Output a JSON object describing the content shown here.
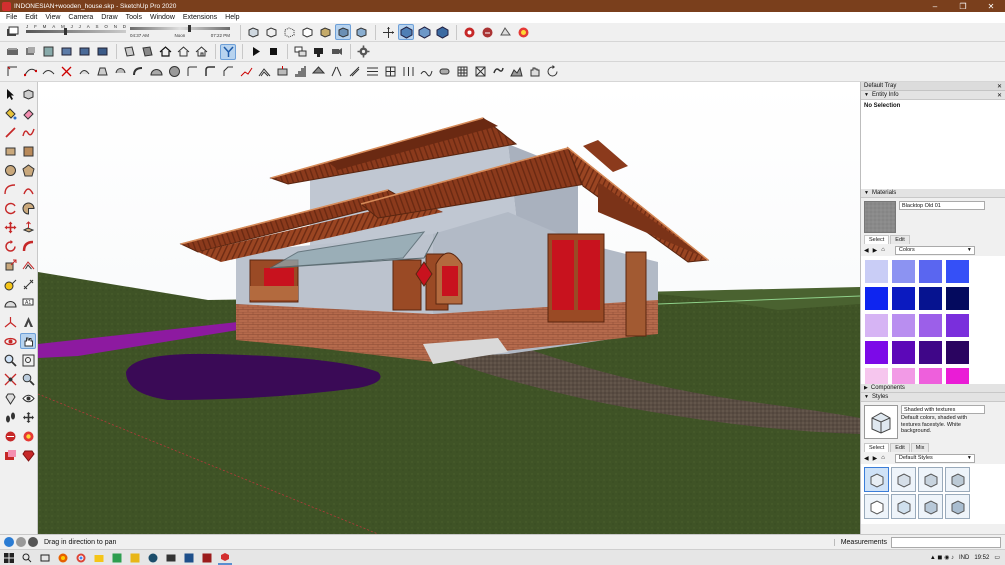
{
  "window": {
    "title": "INDONESIAN+wooden_house.skp - SketchUp Pro 2020",
    "minimize": "–",
    "maximize": "❐",
    "close": "✕"
  },
  "menu": [
    "File",
    "Edit",
    "View",
    "Camera",
    "Draw",
    "Tools",
    "Window",
    "Extensions",
    "Help"
  ],
  "shadow": {
    "months": [
      "J",
      "F",
      "M",
      "A",
      "M",
      "J",
      "J",
      "A",
      "S",
      "O",
      "N",
      "D"
    ],
    "times": [
      "04:37 AM",
      "Noon",
      "07:22 PM"
    ]
  },
  "tray": {
    "title": "Default Tray",
    "entity_info": {
      "title": "Entity Info",
      "selection": "No Selection"
    },
    "materials": {
      "title": "Materials",
      "current": "Blacktop Old 01",
      "tabs": [
        "Select",
        "Edit"
      ],
      "library": "Colors",
      "swatches": [
        "#c9cdf6",
        "#8c93f2",
        "#5a66f0",
        "#3550f7",
        "#0e25f0",
        "#0b1ac0",
        "#061390",
        "#040a5e",
        "#d6b4f4",
        "#b98ef0",
        "#9c5fe9",
        "#7a2fdc",
        "#7c0ae8",
        "#5c08b8",
        "#3f0688",
        "#2a0460",
        "#f6c6ee",
        "#f29ae6",
        "#ee5fdc",
        "#ea1cd6"
      ]
    },
    "components": {
      "title": "Components"
    },
    "styles": {
      "title": "Styles",
      "name": "Shaded with textures",
      "description": "Default colors, shaded with textures facestyle. White background.",
      "tabs": [
        "Select",
        "Edit",
        "Mix"
      ],
      "library": "Default Styles"
    }
  },
  "status": {
    "hint": "Drag in direction to pan",
    "measurements_label": "Measurements"
  },
  "taskbar": {
    "clock": "19:52",
    "language": "IND"
  }
}
